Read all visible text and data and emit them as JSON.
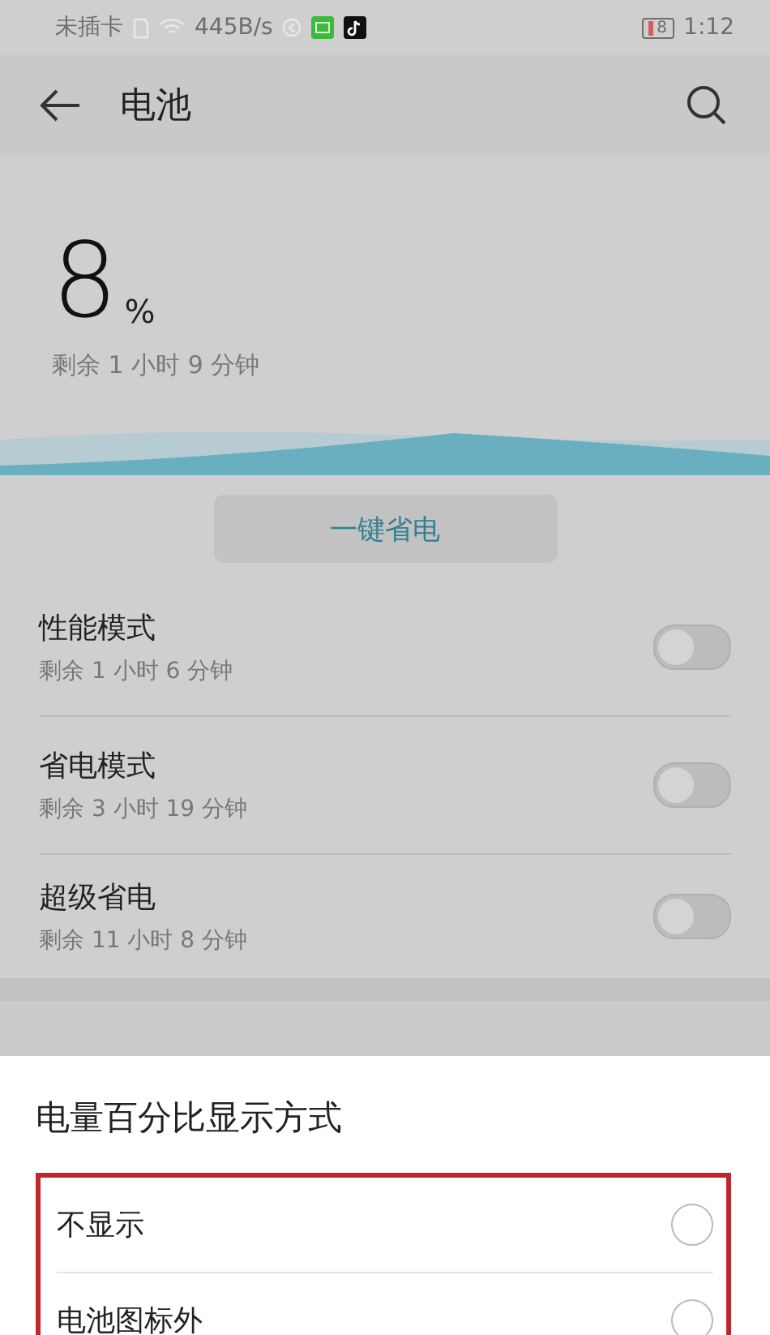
{
  "status_bar": {
    "carrier": "未插卡",
    "speed": "445B/s",
    "battery": "8",
    "time": "1:12"
  },
  "header": {
    "title": "电池"
  },
  "battery": {
    "percent": "8",
    "unit": "%",
    "remaining": "剩余 1 小时 9 分钟"
  },
  "save_button": "一键省电",
  "modes": [
    {
      "title": "性能模式",
      "subtitle": "剩余 1 小时 6 分钟",
      "on": false
    },
    {
      "title": "省电模式",
      "subtitle": "剩余 3 小时 19 分钟",
      "on": false
    },
    {
      "title": "超级省电",
      "subtitle": "剩余 11 小时 8 分钟",
      "on": false
    }
  ],
  "sheet": {
    "title": "电量百分比显示方式",
    "options": [
      {
        "label": "不显示",
        "selected": false
      },
      {
        "label": "电池图标外",
        "selected": false
      }
    ]
  }
}
